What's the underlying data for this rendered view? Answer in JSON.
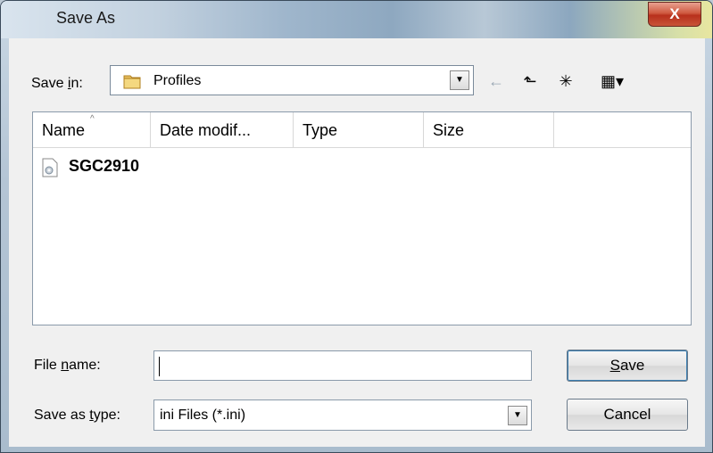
{
  "window": {
    "title": "Save As",
    "close_label": "X"
  },
  "toolbar": {
    "save_in_label_pre": "Save ",
    "save_in_label_u": "i",
    "save_in_label_post": "n:",
    "save_in_value": "Profiles",
    "back_icon": "←",
    "up_icon": "⬑",
    "new_folder_icon": "✳",
    "views_icon": "▦▾"
  },
  "columns": [
    "Name",
    "Date modif...",
    "Type",
    "Size"
  ],
  "files": [
    {
      "name": "SGC2910"
    }
  ],
  "form": {
    "file_name_label_pre": "File ",
    "file_name_label_u": "n",
    "file_name_label_post": "ame:",
    "file_name_value": "",
    "save_type_label_pre": "Save as ",
    "save_type_label_u": "t",
    "save_type_label_post": "ype:",
    "save_type_value": "ini Files (*.ini)"
  },
  "buttons": {
    "save_u": "S",
    "save_rest": "ave",
    "cancel": "Cancel"
  }
}
